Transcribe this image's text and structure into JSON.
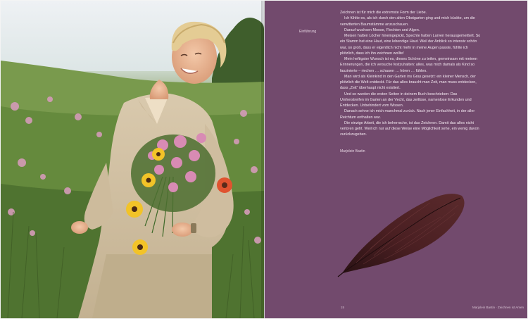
{
  "left_page": {
    "image": "photo-woman-with-wildflower-bouquet"
  },
  "right_page": {
    "background_color": "#724a6d",
    "section_label": "Einführung",
    "paragraphs": [
      "Zeichnen ist für mich die extremste Form der Liebe.",
      "Ich fühlte es, als ich durch den alten Obstgarten ging und mich bückte, um die verwitterten Baumstämme anzuschauen.",
      "Darauf wuchsen Moose, Flechten und Algen.",
      "Meisen hatten Löcher hineingepickt, Spechte hatten Larven heraus­gemeißelt. So ein Stamm hat eine Haut, eine lebendige Haut. Weil der Anblick so intensiv schön war, so groß, dass er eigentlich nicht mehr in meine Augen passte, fühlte ich plötzlich, dass ich ihn zeichnen wollte!",
      "Mein heftigster Wunsch ist es, dieses Schöne zu teilen, gemeinsam mit meinen Erinnerungen, die ich versuche festzuhalten: alles, was mich damals als Kind so faszinierte – riechen … schauen … hören … fühlen.",
      "Man wird als Kleinkind in den Garten ins Gras gesetzt: ein kleiner Mensch, der plötzlich die Welt entdeckt. Für das alles braucht man Zeit, man muss entdecken, dass „Zeit“ überhaupt nicht existiert.",
      "Und so wurden die ersten Seiten in deinem Buch beschrieben: Das Umherstreifen im Garten an der Vecht, das zeitlose, namenlose Erkunden und Entdecken. Unbehindert vom Wissen.",
      "Danach sehne ich mich manchmal zurück. Nach jener Einfachheit, in der aller Reichtum enthalten war.",
      "Die einzige Arbeit, die ich beherrsche, ist das Zeichnen. Damit das alles nicht verloren geht. Weil ich nur auf diese Weise eine Möglichkeit sehe, ein wenig davon zurückzugeben."
    ],
    "author": "Marjolein Bastin",
    "feather_image": "feather-illustration",
    "page_number": "15",
    "running_foot": "Marjolein Bastin · Zeichnen ist Amen"
  }
}
